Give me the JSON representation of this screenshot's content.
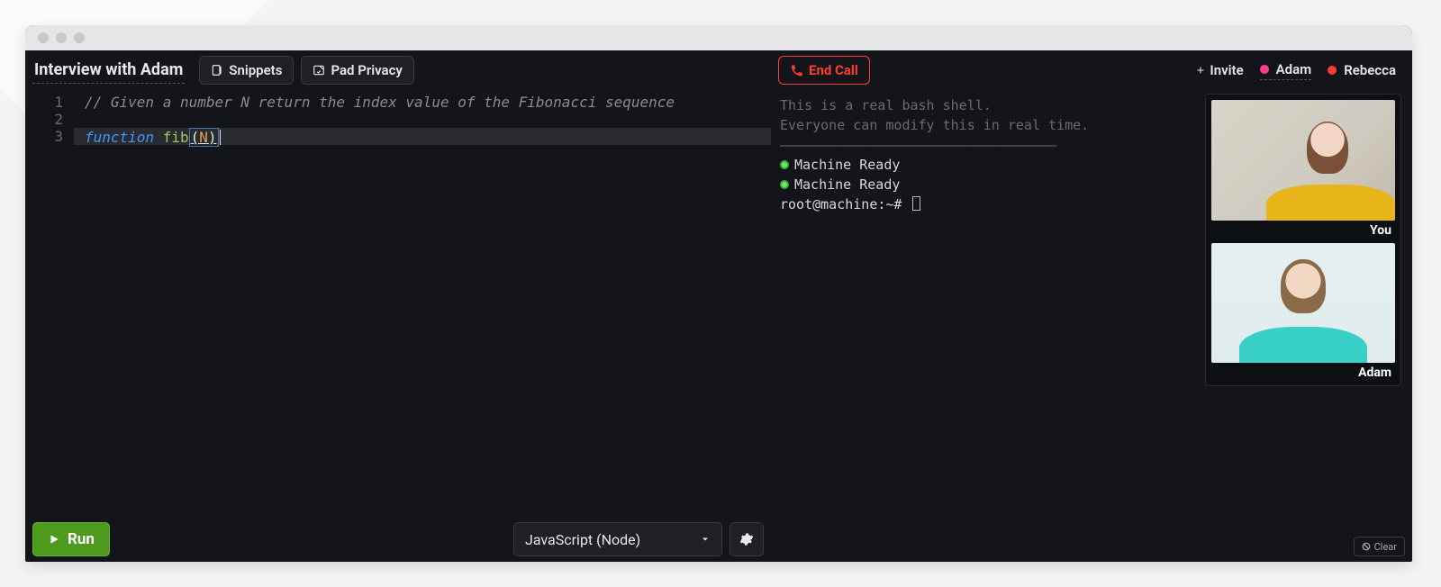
{
  "header": {
    "title": "Interview with Adam",
    "snippets_label": "Snippets",
    "privacy_label": "Pad Privacy"
  },
  "call": {
    "end_call_label": "End Call",
    "invite_label": "Invite"
  },
  "participants": [
    {
      "name": "Adam",
      "color": "#ff3b8d"
    },
    {
      "name": "Rebecca",
      "color": "#ff3b30"
    }
  ],
  "editor": {
    "lines": {
      "l1": {
        "num": "1"
      },
      "l2": {
        "num": "2"
      },
      "l3": {
        "num": "3"
      }
    },
    "comment": "// Given a number N return the index value of the Fibonacci sequence",
    "kw_function": "function",
    "func_name": "fib",
    "paren_open": "(",
    "param": "N",
    "paren_close": ")"
  },
  "footer": {
    "run_label": "Run",
    "language": "JavaScript (Node)"
  },
  "terminal": {
    "intro1": "This is a real bash shell.",
    "intro2": "Everyone can modify this in real time.",
    "divider": "––––––––––––––––––––––––––––––––––",
    "ready1": "Machine Ready",
    "ready2": "Machine Ready",
    "prompt": "root@machine:~# "
  },
  "video": {
    "tile1_label": "You",
    "tile2_label": "Adam"
  },
  "clear_label": "Clear"
}
